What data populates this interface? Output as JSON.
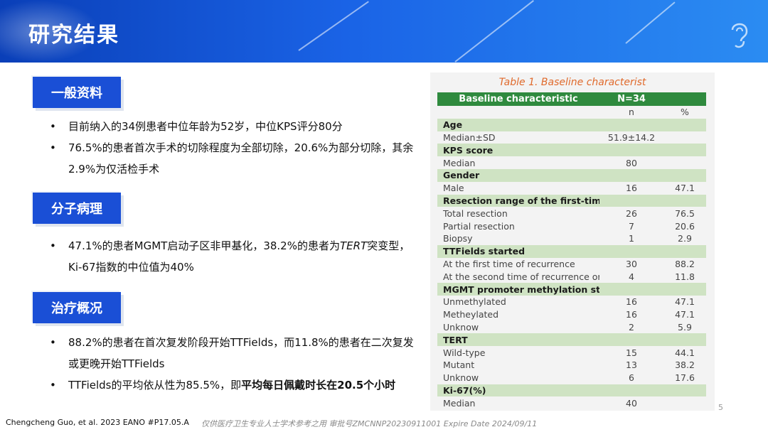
{
  "header": {
    "title": "研究结果"
  },
  "sections": [
    {
      "label": "一般资料",
      "bullets": [
        {
          "parts": [
            {
              "text": "目前纳入的34例患者中位年龄为52岁，中位KPS评分80分"
            }
          ]
        },
        {
          "parts": [
            {
              "text": "76.5%的患者首次手术的切除程度为全部切除，20.6%为部分切除，其余2.9%为仅活检手术"
            }
          ]
        }
      ]
    },
    {
      "label": "分子病理",
      "bullets": [
        {
          "parts": [
            {
              "text": "47.1%的患者MGMT启动子区非甲基化，38.2%的患者为"
            },
            {
              "text": "TERT",
              "italic": true
            },
            {
              "text": "突变型，Ki-67指数的中位值为40%"
            }
          ]
        }
      ]
    },
    {
      "label": "治疗概况",
      "bullets": [
        {
          "parts": [
            {
              "text": "88.2%的患者在首次复发阶段开始TTFields，而11.8%的患者在二次复发或更晚开始TTFields"
            }
          ]
        },
        {
          "parts": [
            {
              "text": "TTFields的平均依从性为85.5%，即"
            },
            {
              "text": "平均每日佩戴时长在20.5个小时",
              "bold": true
            }
          ]
        }
      ]
    }
  ],
  "table": {
    "caption": "Table 1. Baseline characterist",
    "header": [
      "Baseline characteristic",
      "N=34",
      ""
    ],
    "subheader": [
      "",
      "n",
      "%"
    ],
    "rows": [
      {
        "type": "cat",
        "cells": [
          "Age",
          "",
          ""
        ]
      },
      {
        "type": "row",
        "cells": [
          "Median±SD",
          "51.9±14.2",
          ""
        ]
      },
      {
        "type": "cat",
        "cells": [
          "KPS score",
          "",
          ""
        ]
      },
      {
        "type": "row",
        "cells": [
          "Median",
          "80",
          ""
        ]
      },
      {
        "type": "cat",
        "cells": [
          "Gender",
          "",
          ""
        ]
      },
      {
        "type": "row",
        "cells": [
          "Male",
          "16",
          "47.1"
        ]
      },
      {
        "type": "cat",
        "cells": [
          "Resection range of the first-time surgery",
          "",
          ""
        ]
      },
      {
        "type": "row",
        "cells": [
          "Total resection",
          "26",
          "76.5"
        ]
      },
      {
        "type": "row",
        "cells": [
          "Partial resection",
          "7",
          "20.6"
        ]
      },
      {
        "type": "row",
        "cells": [
          "Biopsy",
          "1",
          "2.9"
        ]
      },
      {
        "type": "cat",
        "cells": [
          "TTFields started",
          "",
          ""
        ]
      },
      {
        "type": "row",
        "cells": [
          "At the first time of recurrence",
          "30",
          "88.2"
        ]
      },
      {
        "type": "row",
        "cells": [
          "At the second time of recurrence or latter",
          "4",
          "11.8"
        ]
      },
      {
        "type": "cat",
        "cells": [
          "MGMT promoter methylation status",
          "",
          ""
        ]
      },
      {
        "type": "row",
        "cells": [
          "Unmethylated",
          "16",
          "47.1"
        ]
      },
      {
        "type": "row",
        "cells": [
          "Metheylated",
          "16",
          "47.1"
        ]
      },
      {
        "type": "row",
        "cells": [
          "Unknow",
          "2",
          "5.9"
        ]
      },
      {
        "type": "cat",
        "cells": [
          "TERT",
          "",
          ""
        ]
      },
      {
        "type": "row",
        "cells": [
          "Wild-type",
          "15",
          "44.1"
        ]
      },
      {
        "type": "row",
        "cells": [
          "Mutant",
          "13",
          "38.2"
        ]
      },
      {
        "type": "row",
        "cells": [
          "Unknow",
          "6",
          "17.6"
        ]
      },
      {
        "type": "cat",
        "cells": [
          "Ki-67(%)",
          "",
          ""
        ]
      },
      {
        "type": "row",
        "cells": [
          "Median",
          "40",
          ""
        ]
      }
    ]
  },
  "footer": {
    "citation": "Chengcheng Guo, et al. 2023 EANO #P17.05.A",
    "disclaimer": "仅供医疗卫生专业人士学术参考之用   审批号ZMCNNP20230911001 Expire Date 2024/09/11",
    "page": "5"
  },
  "colors": {
    "header_blue": "#1a4fd6",
    "table_header_green": "#2f8a3e",
    "category_green": "#cfe3c3",
    "caption_orange": "#e06a2c"
  },
  "icons": [
    "brain-icon",
    "ear-icon"
  ]
}
